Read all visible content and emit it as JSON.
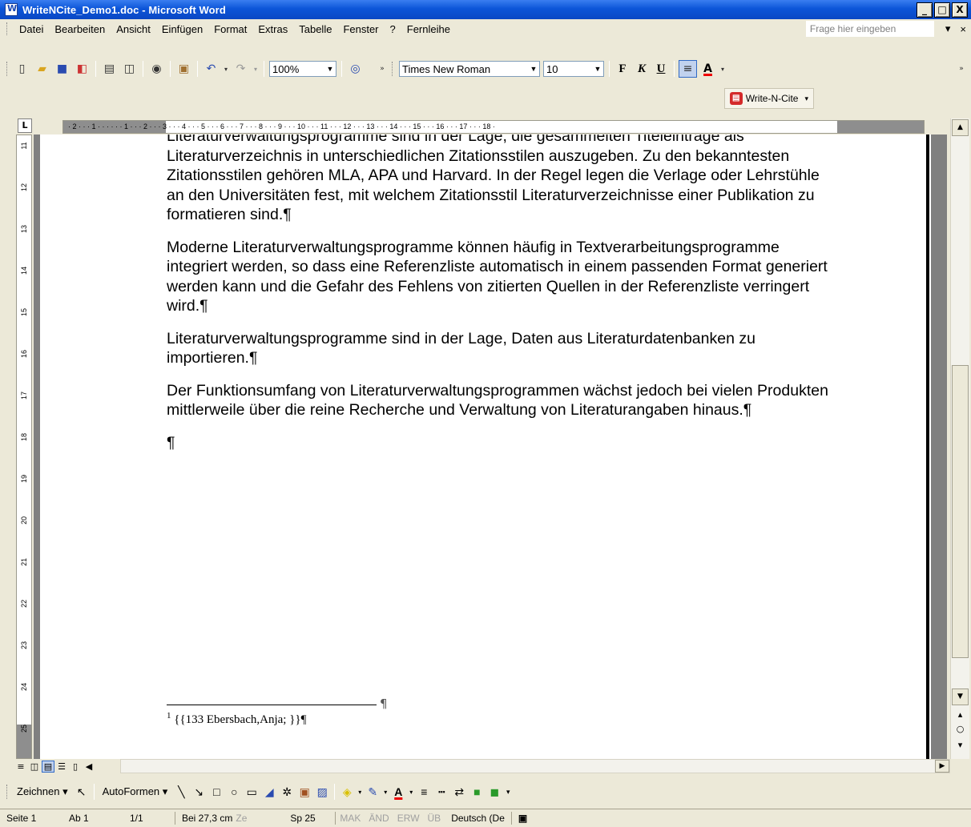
{
  "window": {
    "title": "WriteNCite_Demo1.doc - Microsoft Word",
    "minimize": "_",
    "maximize": "□",
    "close": "X"
  },
  "menu": {
    "items": [
      "Datei",
      "Bearbeiten",
      "Ansicht",
      "Einfügen",
      "Format",
      "Extras",
      "Tabelle",
      "Fenster",
      "?",
      "Fernleihe"
    ],
    "help_placeholder": "Frage hier eingeben",
    "mdi_dropdown": "▾",
    "mdi_close": "×"
  },
  "standard_toolbar": {
    "zoom": "100%"
  },
  "format_toolbar": {
    "font": "Times New Roman",
    "size": "10",
    "bold": "F",
    "italic": "K",
    "underline": "U"
  },
  "writencite": {
    "label": "Write-N-Cite"
  },
  "ruler": {
    "corner": "L",
    "hticks": "· 2 · · · 1 · · ·    · · · 1 · · · 2 · · · 3 · · · 4 · · · 5 · · · 6 · · · 7 · · · 8 · · · 9 · · · 10 · · · 11 · · · 12 · · · 13 · · · 14 · · · 15 · · · 16 · · · 17 · · · 18 ·",
    "vticks": [
      "11",
      "12",
      "13",
      "14",
      "15",
      "16",
      "17",
      "18",
      "19",
      "20",
      "21",
      "22",
      "23",
      "24",
      "25"
    ]
  },
  "document": {
    "paragraphs": [
      "Literaturverwaltungsprogramme sind in der Lage, die gesammelten Titeleinträge als Literaturverzeichnis in unterschiedlichen Zitationsstilen auszugeben. Zu den bekanntesten Zitationsstilen gehören MLA, APA und Harvard. In der Regel legen die Verlage oder Lehrstühle an den Universitäten fest, mit welchem Zitationsstil Literaturverzeichnisse einer Publikation zu formatieren sind.¶",
      "Moderne Literaturverwaltungsprogramme können häufig in Textverarbeitungsprogramme integriert werden, so dass eine Referenzliste automatisch in einem passenden Format generiert werden kann und die Gefahr des Fehlens von zitierten Quellen in der Referenzliste verringert wird.¶",
      "Literaturverwaltungsprogramme sind in der Lage, Daten aus Literaturdatenbanken zu importieren.¶",
      "Der Funktionsumfang von Literaturverwaltungsprogrammen wächst jedoch bei vielen Produkten mittlerweile über die reine Recherche und Verwaltung von Literaturangaben hinaus.¶",
      "¶"
    ],
    "footnote_separator_mark": "¶",
    "footnote_number": "1",
    "footnote_text": " {{133 Ebersbach,Anja; }}¶"
  },
  "drawing_toolbar": {
    "draw": "Zeichnen ▾",
    "autoshapes": "AutoFormen ▾"
  },
  "status": {
    "page": "Seite 1",
    "section": "Ab 1",
    "pages": "1/1",
    "position": "Bei 27,3 cm",
    "line": "Ze",
    "column": "Sp 25",
    "mak": "MAK",
    "and": "ÄND",
    "erw": "ERW",
    "ub": "ÜB",
    "language": "Deutsch (De"
  }
}
